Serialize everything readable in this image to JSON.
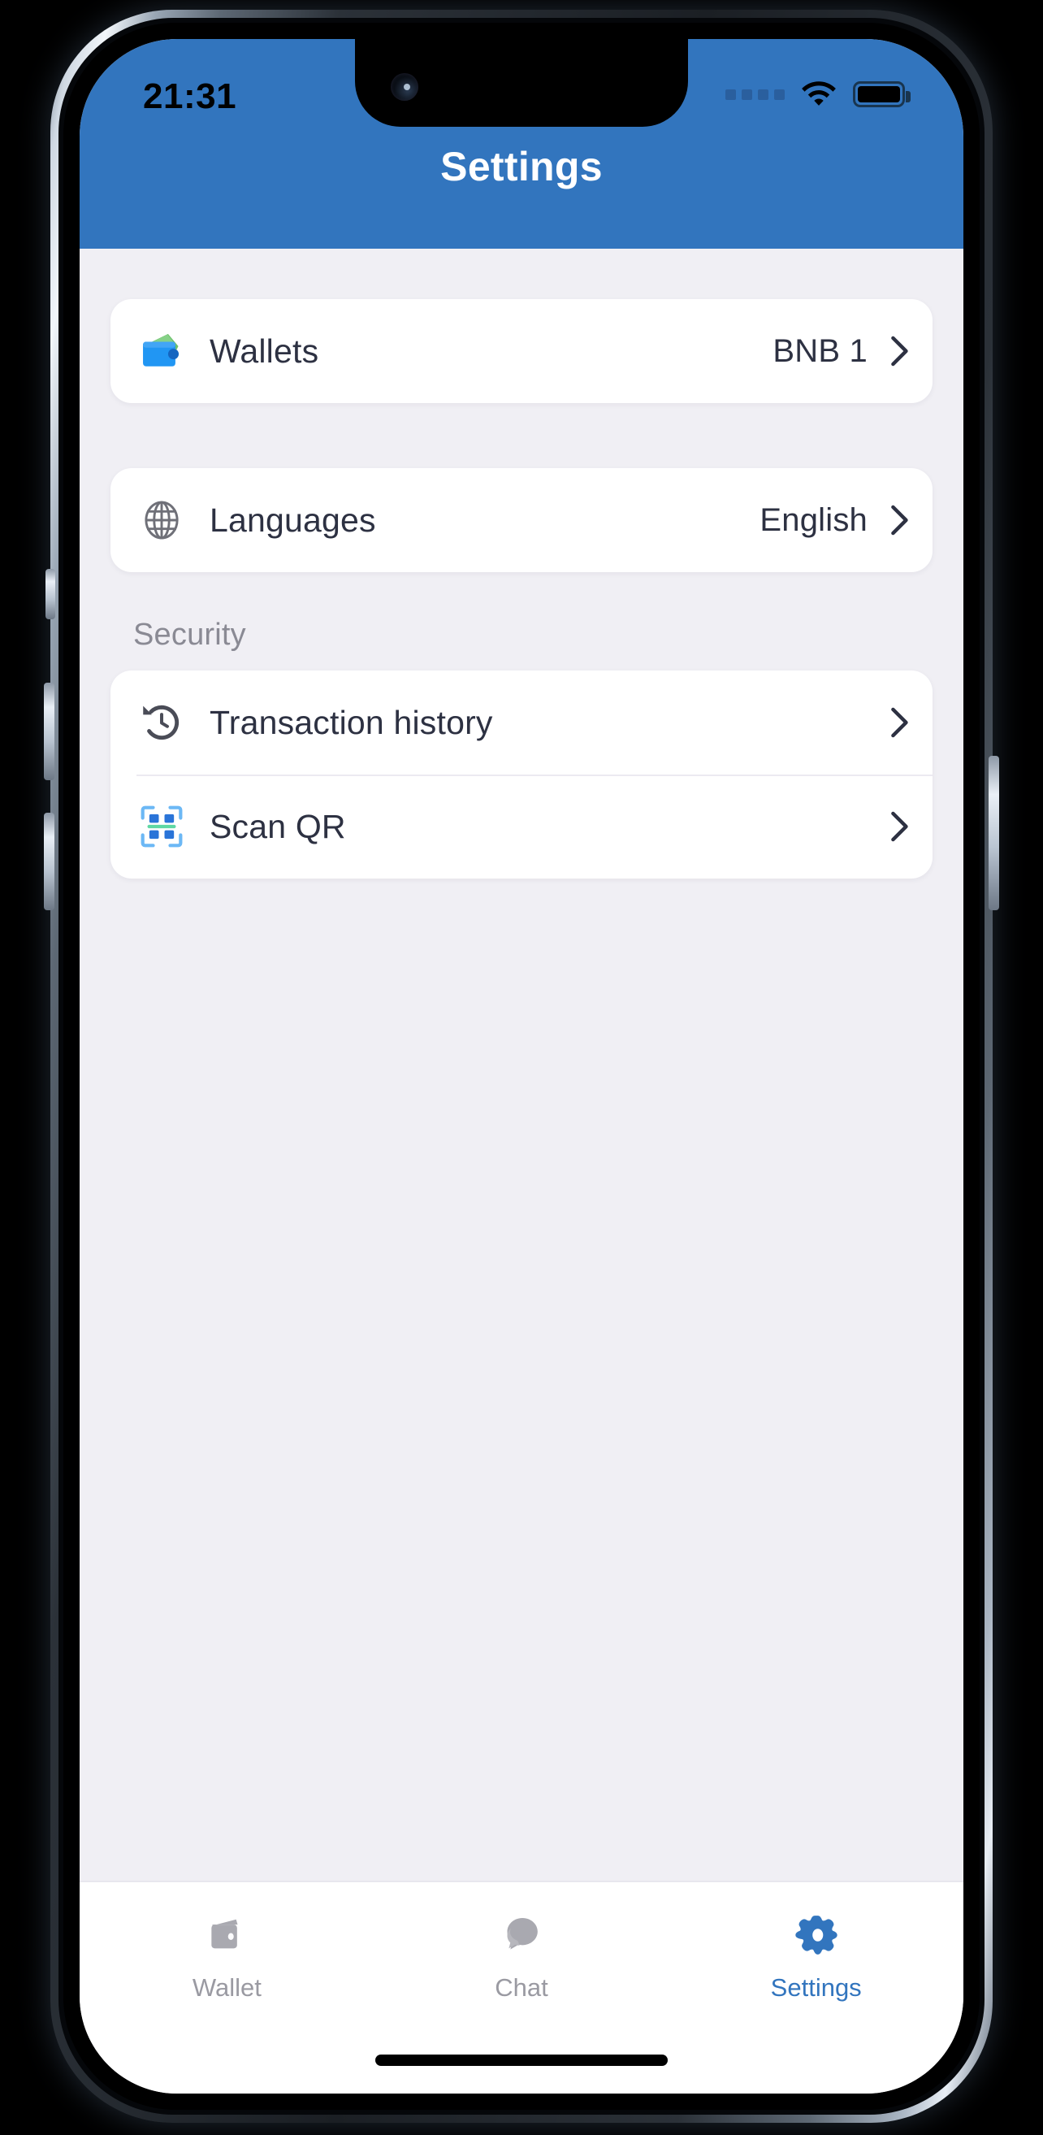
{
  "device": {
    "status_bar": {
      "time": "21:31",
      "signal_icon": "signal-dots-icon",
      "wifi_icon": "wifi-icon",
      "battery_icon": "battery-full-icon"
    },
    "notch": {
      "camera_icon": "front-camera-icon",
      "speaker_icon": "earpiece-speaker-icon"
    },
    "home_indicator": "home-indicator"
  },
  "header": {
    "title": "Settings",
    "background_color": "#3275be",
    "title_color": "#ffffff"
  },
  "colors": {
    "accent": "#3275be",
    "page_background": "#f0eff4",
    "card_background": "#ffffff",
    "text_primary": "#2d3142",
    "text_muted": "#8a8a94",
    "divider": "#eceaf1"
  },
  "content": {
    "groups": [
      {
        "section_label": null,
        "rows": [
          {
            "id": "wallets",
            "icon": "wallet-icon",
            "label": "Wallets",
            "value": "BNB 1",
            "chevron": "chevron-right-icon"
          }
        ]
      },
      {
        "section_label": null,
        "rows": [
          {
            "id": "languages",
            "icon": "globe-icon",
            "label": "Languages",
            "value": "English",
            "chevron": "chevron-right-icon"
          }
        ]
      },
      {
        "section_label": "Security",
        "rows": [
          {
            "id": "transaction-history",
            "icon": "history-clock-icon",
            "label": "Transaction history",
            "value": "",
            "chevron": "chevron-right-icon"
          },
          {
            "id": "scan-qr",
            "icon": "qr-scan-icon",
            "label": "Scan QR",
            "value": "",
            "chevron": "chevron-right-icon"
          }
        ]
      }
    ]
  },
  "tabbar": {
    "active_index": 2,
    "tabs": [
      {
        "id": "wallet",
        "icon": "wallet-tab-icon",
        "label": "Wallet",
        "active": false
      },
      {
        "id": "chat",
        "icon": "chat-bubble-icon",
        "label": "Chat",
        "active": false
      },
      {
        "id": "settings",
        "icon": "gear-icon",
        "label": "Settings",
        "active": true
      }
    ]
  }
}
